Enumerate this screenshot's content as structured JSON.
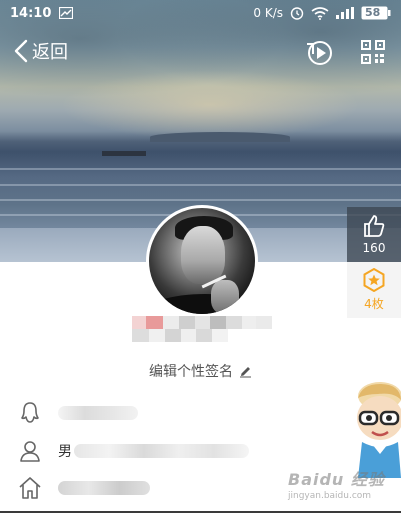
{
  "status_bar": {
    "time": "14:10",
    "network_speed": "0 K/s",
    "battery": "58"
  },
  "nav": {
    "back_label": "返回"
  },
  "side_actions": {
    "like_count": "160",
    "star_count": "4枚"
  },
  "profile": {
    "signature_label": "编辑个性签名",
    "gender": "男"
  },
  "watermark": {
    "brand": "Baidu 经验",
    "url": "jingyan.baidu.com"
  },
  "colors": {
    "accent_orange": "#f5a623",
    "like_panel_bg": "#3c4652",
    "text_gray": "#555555"
  },
  "icons": {
    "back": "chevron-left-icon",
    "music": "music-play-icon",
    "qr": "qr-code-icon",
    "like": "thumbs-up-icon",
    "star": "star-badge-icon",
    "edit": "pencil-icon",
    "qq": "penguin-icon",
    "person": "person-icon",
    "home": "home-icon"
  }
}
